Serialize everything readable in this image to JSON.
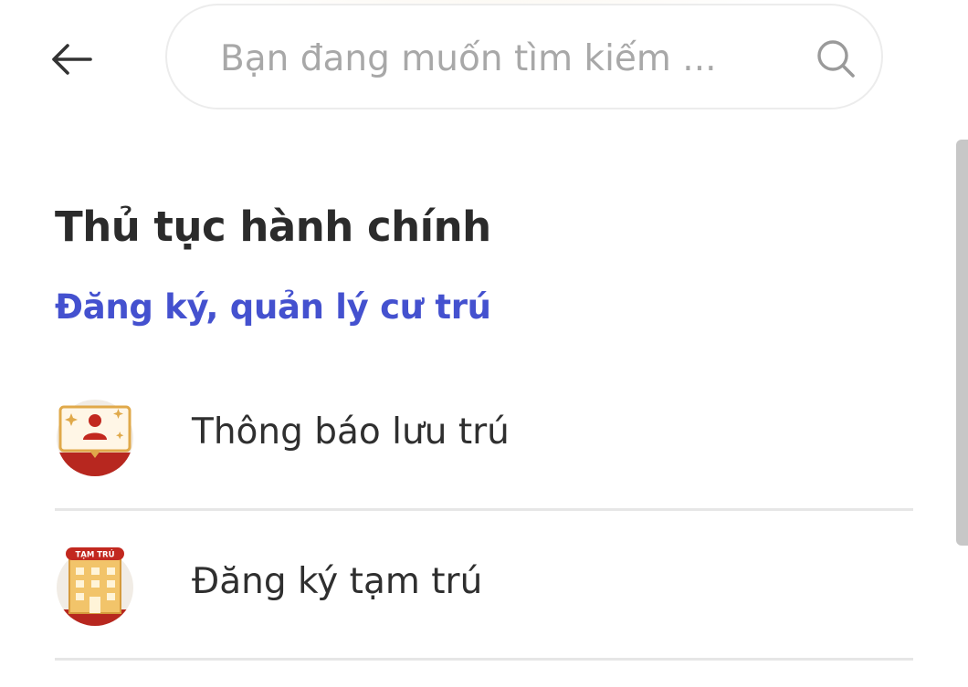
{
  "search": {
    "placeholder": "Bạn đang muốn tìm kiếm ..."
  },
  "section": {
    "title": "Thủ tục hành chính",
    "subtitle": "Đăng ký, quản lý cư trú"
  },
  "items": [
    {
      "label": "Thông báo lưu trú",
      "icon": "residence-notice-icon"
    },
    {
      "label": "Đăng ký tạm trú",
      "icon": "temporary-residence-icon",
      "icon_text": "TẠM TRÚ"
    }
  ],
  "colors": {
    "accent": "#4451cf",
    "brand_red": "#b7271f",
    "gold": "#e0a94a",
    "text": "#2f2f2f"
  }
}
